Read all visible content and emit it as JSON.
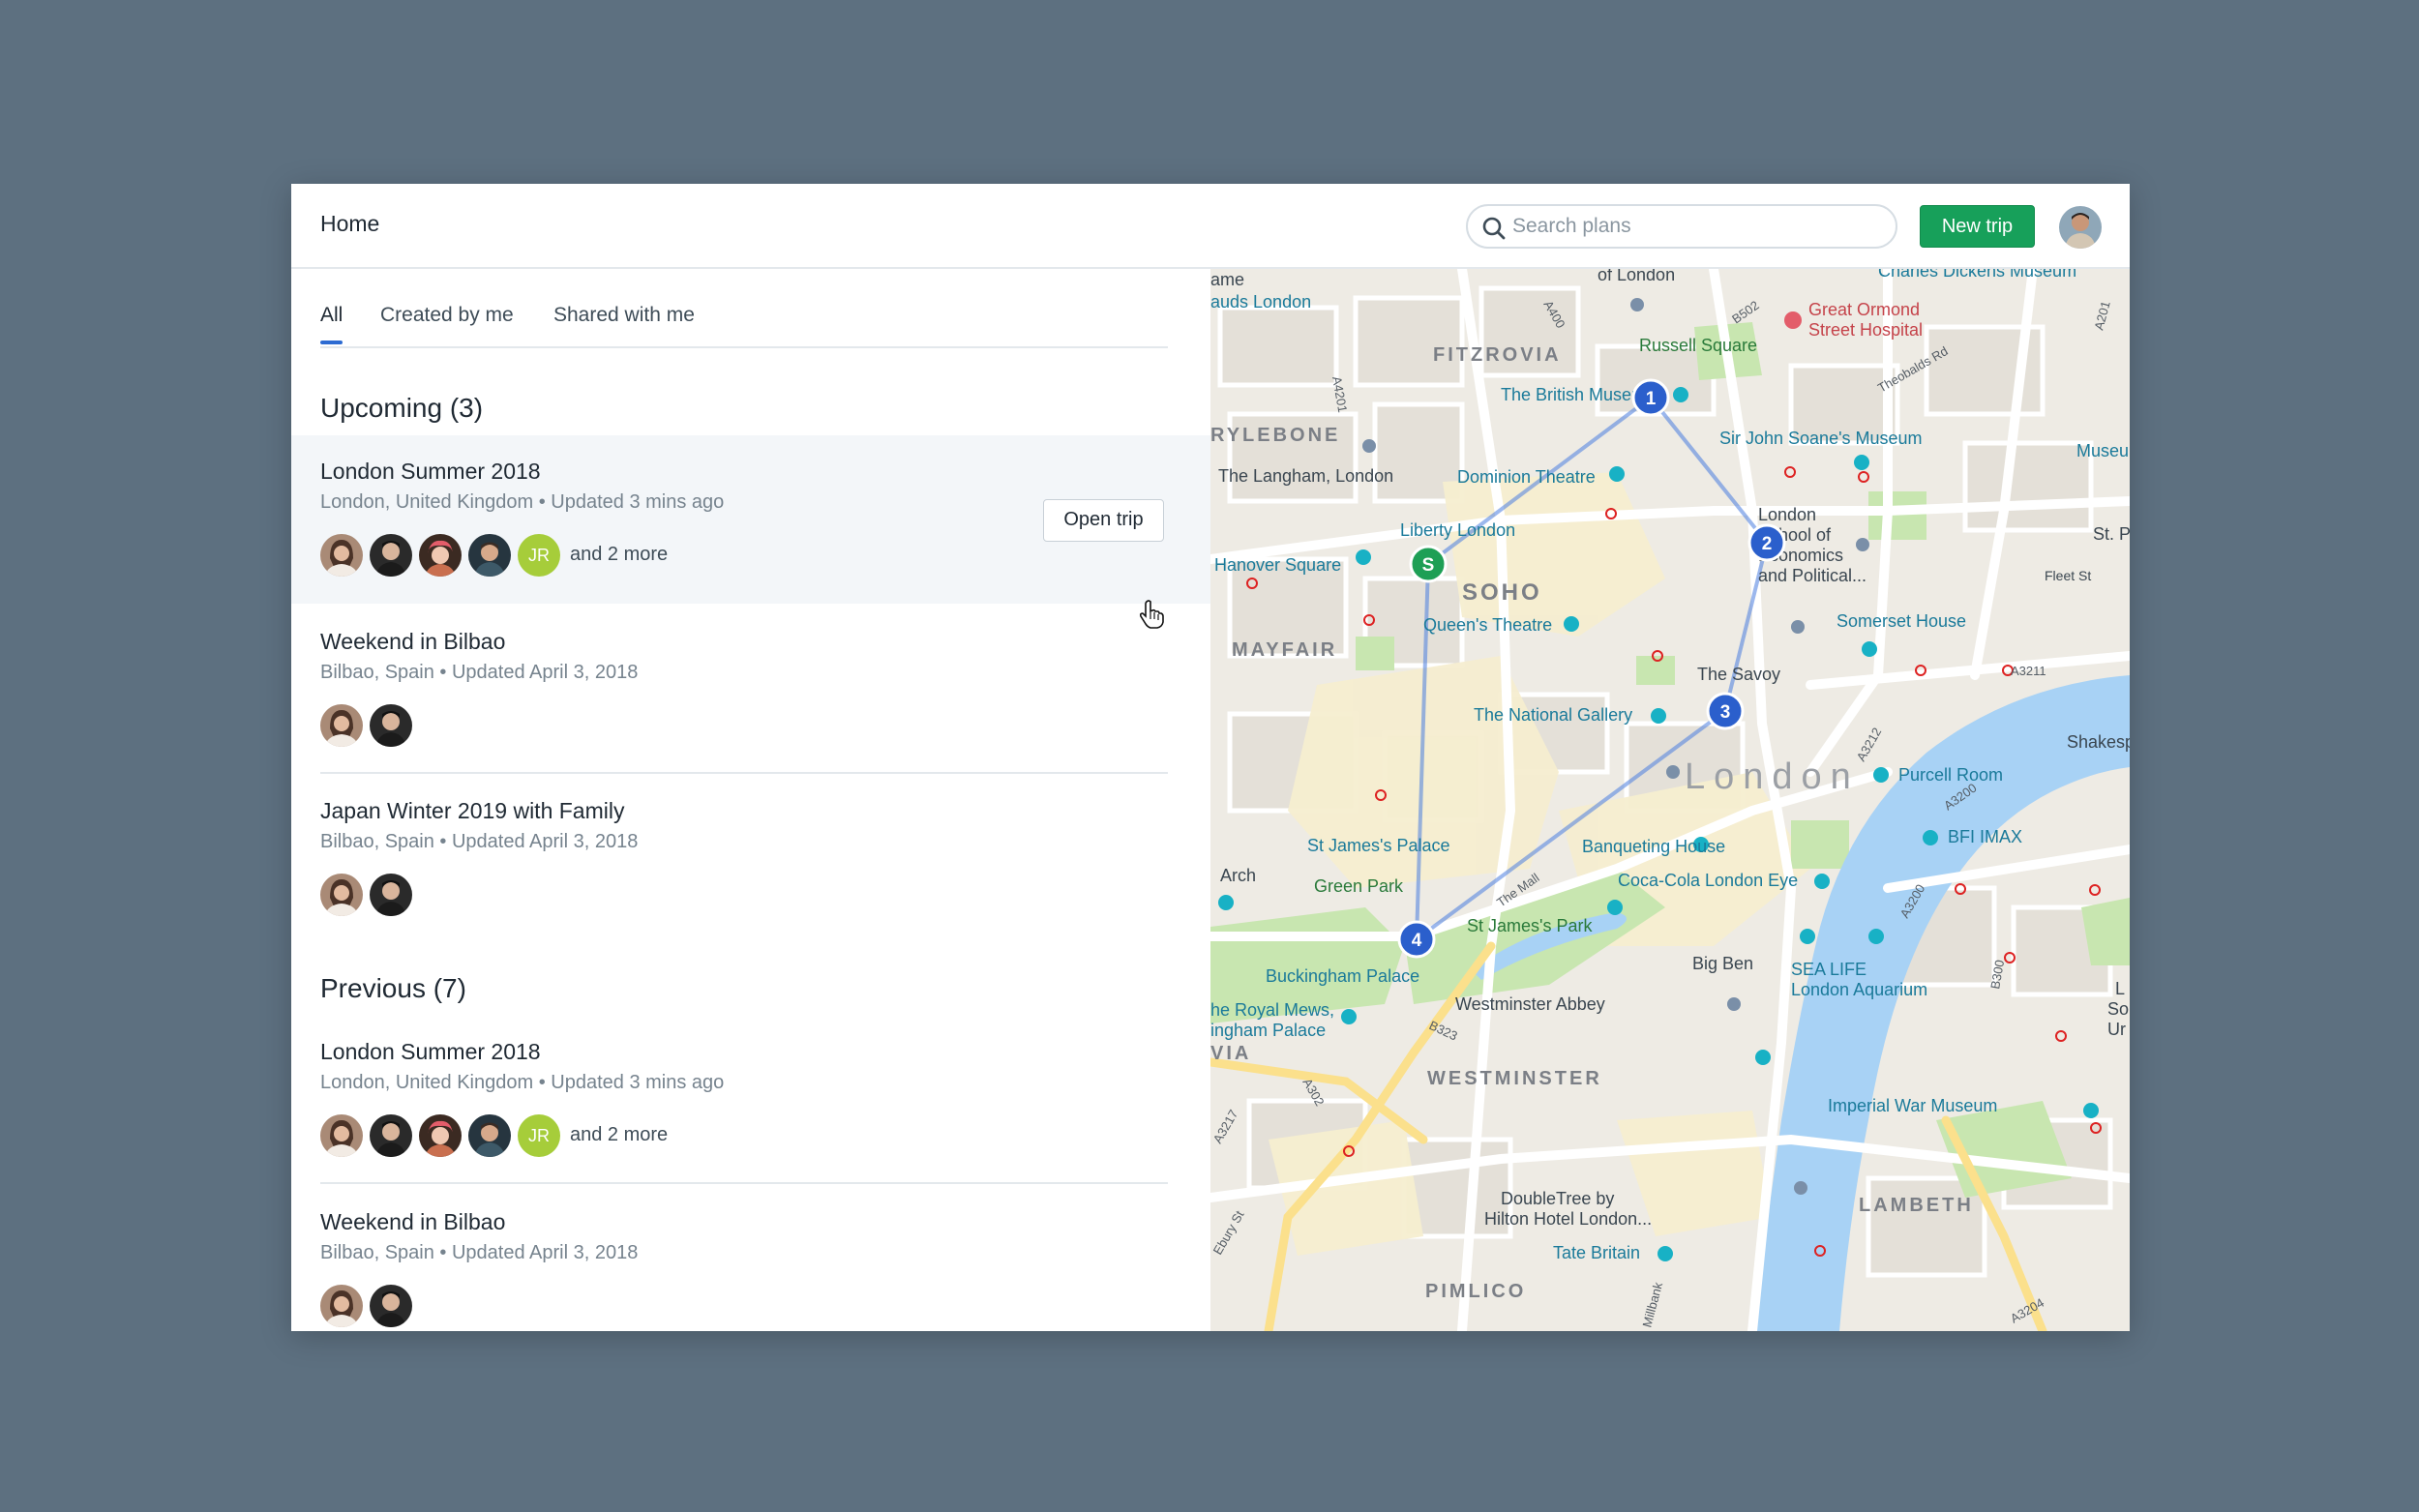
{
  "header": {
    "title": "Home",
    "search_placeholder": "Search plans",
    "new_trip_label": "New trip"
  },
  "tabs": [
    {
      "label": "All",
      "active": true
    },
    {
      "label": "Created by me",
      "active": false
    },
    {
      "label": "Shared with me",
      "active": false
    }
  ],
  "upcoming": {
    "title": "Upcoming (3)",
    "trips": [
      {
        "title": "London Summer 2018",
        "meta": "London, United Kingdom • Updated 3 mins ago",
        "more": "and 2 more",
        "initials": "JR",
        "open_label": "Open trip"
      },
      {
        "title": "Weekend in Bilbao",
        "meta": "Bilbao, Spain • Updated April 3, 2018"
      },
      {
        "title": "Japan Winter 2019 with Family",
        "meta": "Bilbao, Spain • Updated April 3, 2018"
      }
    ]
  },
  "previous": {
    "title": "Previous (7)",
    "trips": [
      {
        "title": "London Summer 2018",
        "meta": "London, United Kingdom • Updated 3 mins ago",
        "more": "and 2 more",
        "initials": "JR"
      },
      {
        "title": "Weekend in Bilbao",
        "meta": "Bilbao, Spain • Updated April 3, 2018"
      }
    ]
  },
  "map": {
    "markers": {
      "start": "S",
      "stop1": "1",
      "stop2": "2",
      "stop3": "3",
      "stop4": "4"
    },
    "areas": {
      "fitzrovia": "FITZROVIA",
      "marylebone": "RYLEBONE",
      "soho": "SOHO",
      "mayfair": "MAYFAIR",
      "london": "London",
      "westminster": "WESTMINSTER",
      "lambeth": "LAMBETH",
      "pimlico": "PIMLICO",
      "via": "VIA"
    },
    "labels": {
      "ame": "ame",
      "auds": "auds London",
      "oflondon": "of London",
      "dickens": "Charles Dickens Museum",
      "ormond1": "Great Ormond",
      "ormond2": "Street Hospital",
      "russell": "Russell Square",
      "british": "The British Museu",
      "soane": "Sir John Soane's Museum",
      "museu": "Museu",
      "langham": "The Langham, London",
      "dominion": "Dominion Theatre",
      "liberty": "Liberty London",
      "lse1": "London",
      "lse2": "School of",
      "lse3": "Economics",
      "lse4": "and Political...",
      "stp": "St. P",
      "fleet": "Fleet St",
      "hanover": "Hanover Square",
      "queens": "Queen's Theatre",
      "somerset": "Somerset House",
      "savoy": "The Savoy",
      "national": "The National Gallery",
      "shakesp": "Shakesp",
      "purcell": "Purcell Room",
      "bfi": "BFI IMAX",
      "stjamespalace": "St James's Palace",
      "banqueting": "Banqueting House",
      "arch": "Arch",
      "greenpark": "Green Park",
      "eye": "Coca-Cola London Eye",
      "stjamespark": "St James's Park",
      "bigben": "Big Ben",
      "sealife1": "SEA LIFE",
      "sealife2": "London Aquarium",
      "buckingham": "Buckingham Palace",
      "royalmews1": "he Royal Mews,",
      "royalmews2": "ingham Palace",
      "abbey": "Westminster Abbey",
      "imperial": "Imperial War Museum",
      "doubletree1": "DoubleTree by",
      "doubletree2": "Hilton Hotel London...",
      "tate": "Tate Britain",
      "lso": "L",
      "lso2": "So",
      "lso3": "Ur",
      "a400": "A400",
      "a4201": "A4201",
      "b502": "B502",
      "theobalds": "Theobalds Rd",
      "a3211": "A3211",
      "a3200": "A3200",
      "a3212": "A3212",
      "a3204": "A3204",
      "b323": "B323",
      "a302": "A302",
      "b300": "B300",
      "a3217": "A3217",
      "ebury": "Ebury St",
      "themall": "The Mall",
      "a3200b": "A3200",
      "millbank": "Millbank",
      "a201": "A201"
    }
  },
  "colors": {
    "accent": "#2d6bd2",
    "primary_button": "#17a05a",
    "marker_blue": "#2b5fcc",
    "marker_green": "#1e9f55",
    "river": "#a8d2f5",
    "park": "#c8e6b0"
  }
}
